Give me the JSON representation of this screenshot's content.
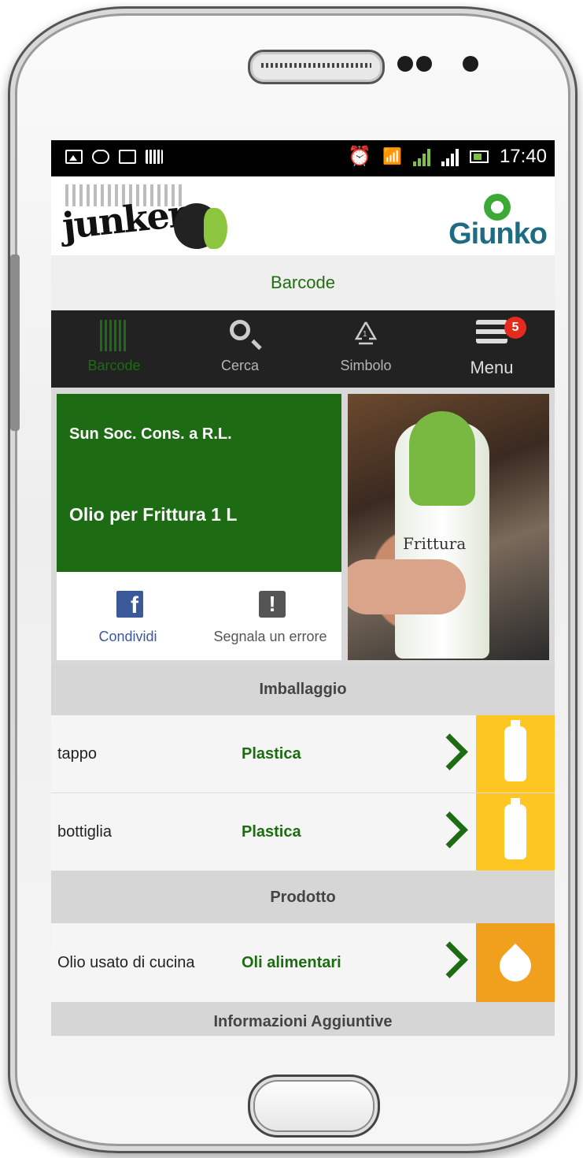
{
  "statusbar": {
    "time": "17:40",
    "left_icons": [
      "image-icon",
      "chat-icon",
      "mail-icon",
      "barcode-notify-icon"
    ],
    "right_icons": [
      "alarm-icon",
      "wifi-icon",
      "signal-sim1-icon",
      "signal-sim2-icon",
      "battery-icon"
    ]
  },
  "header": {
    "left_logo_text": "junker",
    "right_logo_text": "Giunko"
  },
  "title_bar": {
    "title": "Barcode"
  },
  "nav": {
    "items": [
      {
        "label": "Barcode",
        "icon": "barcode-icon",
        "active": true
      },
      {
        "label": "Cerca",
        "icon": "search-icon",
        "active": false
      },
      {
        "label": "Simbolo",
        "icon": "recycle-icon",
        "active": false
      },
      {
        "label": "Menu",
        "icon": "menu-icon",
        "active": false,
        "badge": "5"
      }
    ]
  },
  "product": {
    "maker": "Sun Soc. Cons. a R.L.",
    "name": "Olio per Frittura 1 L",
    "photo_label": "Frittura",
    "actions": {
      "share_label": "Condividi",
      "report_label": "Segnala un errore"
    }
  },
  "sections": {
    "packaging": {
      "title": "Imballaggio",
      "rows": [
        {
          "name": "tappo",
          "material": "Plastica",
          "bin_color": "#fdc623",
          "icon": "bottle-icon"
        },
        {
          "name": "bottiglia",
          "material": "Plastica",
          "bin_color": "#fdc623",
          "icon": "bottle-icon"
        }
      ]
    },
    "product": {
      "title": "Prodotto",
      "rows": [
        {
          "name": "Olio usato di cucina",
          "material": "Oli alimentari",
          "bin_color": "#f0a01c",
          "icon": "drop-icon"
        }
      ]
    },
    "info": {
      "title": "Informazioni Aggiuntive"
    }
  },
  "colors": {
    "brand_green": "#1d6b12",
    "nav_bg": "#222222",
    "yellow_bin": "#fdc623",
    "orange_bin": "#f0a01c",
    "badge_red": "#e52a1e"
  }
}
